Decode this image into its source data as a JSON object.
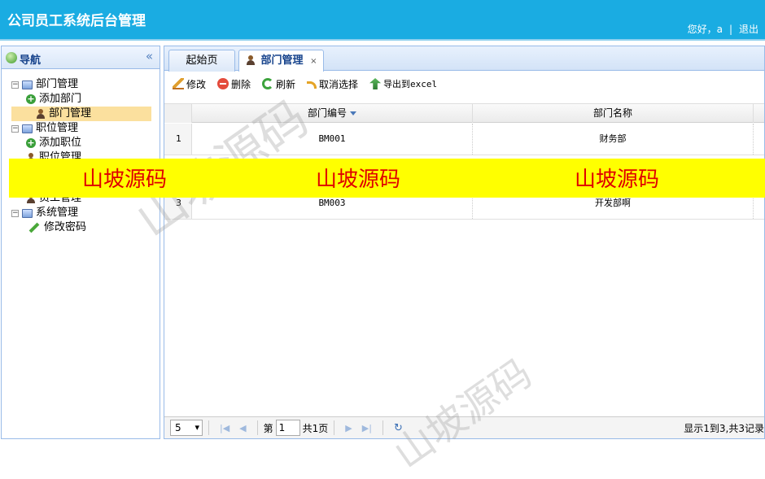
{
  "header": {
    "title": "公司员工系统后台管理",
    "greeting": "您好，a",
    "separator": "|",
    "logout": "退出"
  },
  "sidebar": {
    "title": "导航",
    "collapse_icon": "«",
    "items": [
      {
        "label": "部门管理",
        "icon": "monitor-icon",
        "level": 0
      },
      {
        "label": "添加部门",
        "icon": "add-icon",
        "level": 1
      },
      {
        "label": "部门管理",
        "icon": "user-icon",
        "level": 1,
        "selected": true
      },
      {
        "label": "职位管理",
        "icon": "monitor-icon",
        "level": 0
      },
      {
        "label": "添加职位",
        "icon": "add-icon",
        "level": 1
      },
      {
        "label": "职位管理",
        "icon": "user-icon",
        "level": 1
      },
      {
        "label": "员工管理",
        "icon": "user-icon",
        "level": 1
      },
      {
        "label": "系统管理",
        "icon": "monitor-icon",
        "level": 0
      },
      {
        "label": "修改密码",
        "icon": "pencil-icon",
        "level": 1
      }
    ]
  },
  "tabs": [
    {
      "label": "起始页",
      "active": false
    },
    {
      "label": "部门管理",
      "active": true,
      "close": "×"
    }
  ],
  "toolbar": {
    "edit": "修改",
    "delete": "删除",
    "refresh": "刷新",
    "cancel_select": "取消选择",
    "export": "导出到excel"
  },
  "grid": {
    "columns": [
      "部门编号",
      "部门名称"
    ],
    "rows": [
      {
        "num": "1",
        "code": "BM001",
        "name": "财务部"
      },
      {
        "num": "3",
        "code": "BM003",
        "name": "开发部啊"
      }
    ]
  },
  "pager": {
    "page_size": "5",
    "page_prefix": "第",
    "page_value": "1",
    "page_suffix": "共1页",
    "info": "显示1到3,共3记录"
  },
  "watermark": {
    "text": "山坡源码",
    "band_color": "#ffff00",
    "text_color": "#e00000"
  },
  "colors": {
    "header_bg": "#1aace2",
    "panel_border": "#99bbe8",
    "selected_row": "#fbe09e"
  }
}
